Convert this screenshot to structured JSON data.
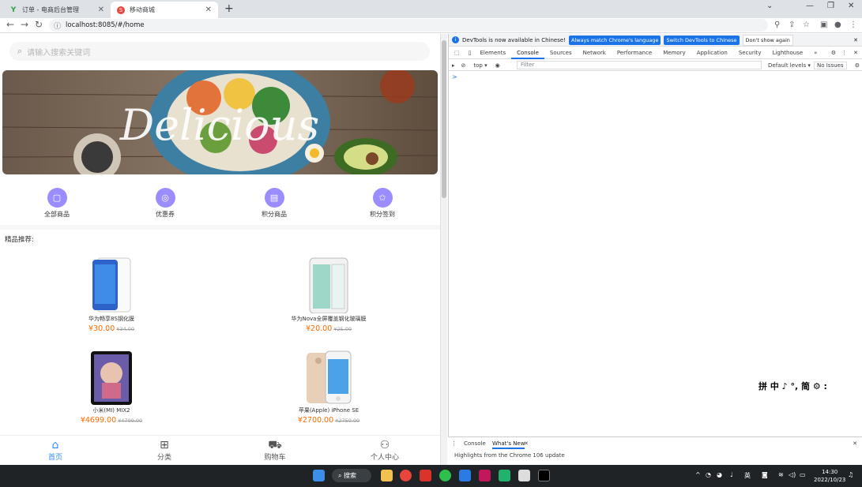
{
  "browser": {
    "tabs": [
      {
        "title": "订单 - 电商后台管理",
        "favicon": "Y"
      },
      {
        "title": "移动商城",
        "favicon": "S"
      }
    ],
    "url": "localhost:8085/#/home"
  },
  "app": {
    "search_placeholder": "请输入搜索关键词",
    "banner_text": "Delicious",
    "quick_nav": [
      {
        "label": "全部商品",
        "icon": "cart-bag-icon"
      },
      {
        "label": "优惠券",
        "icon": "bulb-icon"
      },
      {
        "label": "积分商品",
        "icon": "book-icon"
      },
      {
        "label": "积分签到",
        "icon": "star-icon"
      }
    ],
    "section_title": "精品推荐:",
    "products": [
      {
        "name": "华为畅享8S钢化膜",
        "price": "¥30.00",
        "old_price": "¥34.00"
      },
      {
        "name": "华为Nova全屏覆盖钢化玻璃膜",
        "price": "¥20.00",
        "old_price": "¥25.00"
      },
      {
        "name": "小米(MI) MIX2",
        "price": "¥4699.00",
        "old_price": "¥4799.00"
      },
      {
        "name": "苹果(Apple) iPhone SE",
        "price": "¥2700.00",
        "old_price": "¥2750.00"
      }
    ],
    "tabbar": [
      {
        "label": "首页",
        "icon": "home-icon"
      },
      {
        "label": "分类",
        "icon": "grid-icon"
      },
      {
        "label": "购物车",
        "icon": "cart-icon"
      },
      {
        "label": "个人中心",
        "icon": "user-icon"
      }
    ]
  },
  "devtools": {
    "info_text": "DevTools is now available in Chinese!",
    "btn_match": "Always match Chrome's language",
    "btn_switch": "Switch DevTools to Chinese",
    "btn_dont": "Don't show again",
    "tabs": [
      "Elements",
      "Console",
      "Sources",
      "Network",
      "Performance",
      "Memory",
      "Application",
      "Security",
      "Lighthouse"
    ],
    "context": "top",
    "filter_placeholder": "Filter",
    "levels": "Default levels",
    "issues": "No Issues",
    "prompt": ">",
    "drawer_tabs": [
      "Console",
      "What's New"
    ],
    "highlights": "Highlights from the Chrome 106 update"
  },
  "ime": "拼 中 ♪ °, 简 ⚙ :",
  "taskbar": {
    "search": "搜索",
    "lang": "英",
    "time": "14:30",
    "date": "2022/10/23"
  },
  "colors": {
    "accent": "#9b8cff",
    "price": "#ff6a00",
    "active_tab": "#2e8bff"
  }
}
